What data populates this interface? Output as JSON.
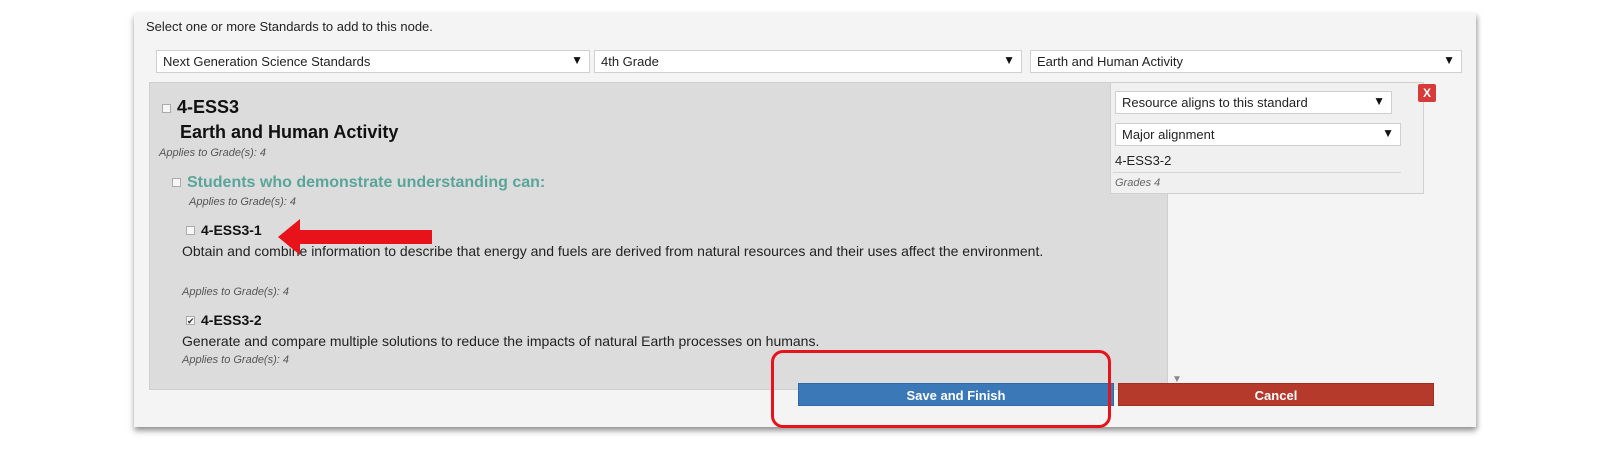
{
  "dialog": {
    "instruction": "Select one or more Standards to add to this node."
  },
  "filters": {
    "framework": "Next Generation Science Standards",
    "grade": "4th Grade",
    "domain": "Earth and Human Activity"
  },
  "standards": {
    "code": "4-ESS3",
    "name": "Earth and Human Activity",
    "applies": "Applies to Grade(s): 4",
    "subheading": "Students who demonstrate understanding can:",
    "sub_applies": "Applies to Grade(s): 4",
    "items": [
      {
        "code": "4-ESS3-1",
        "checked": false,
        "description": "Obtain and combine information to describe that energy and fuels are derived from natural resources and their uses affect the environment.",
        "applies": "Applies to Grade(s): 4"
      },
      {
        "code": "4-ESS3-2",
        "checked": true,
        "description": "Generate and compare multiple solutions to reduce the impacts of natural Earth processes on humans.",
        "applies": "Applies to Grade(s): 4"
      }
    ]
  },
  "selected_card": {
    "alignment": "Resource aligns to this standard",
    "strength": "Major alignment",
    "code": "4-ESS3-2",
    "grades": "Grades 4",
    "remove_label": "X"
  },
  "buttons": {
    "save": "Save and Finish",
    "cancel": "Cancel"
  },
  "icons": {
    "dropdown": "chevron-down-icon",
    "checkbox": "checkbox-icon",
    "annotation": "red-arrow-annotation"
  },
  "colors": {
    "save": "#3a78b8",
    "cancel": "#b53a2c",
    "accent_teal": "#5aa59a",
    "annotation_red": "#e8121b"
  }
}
